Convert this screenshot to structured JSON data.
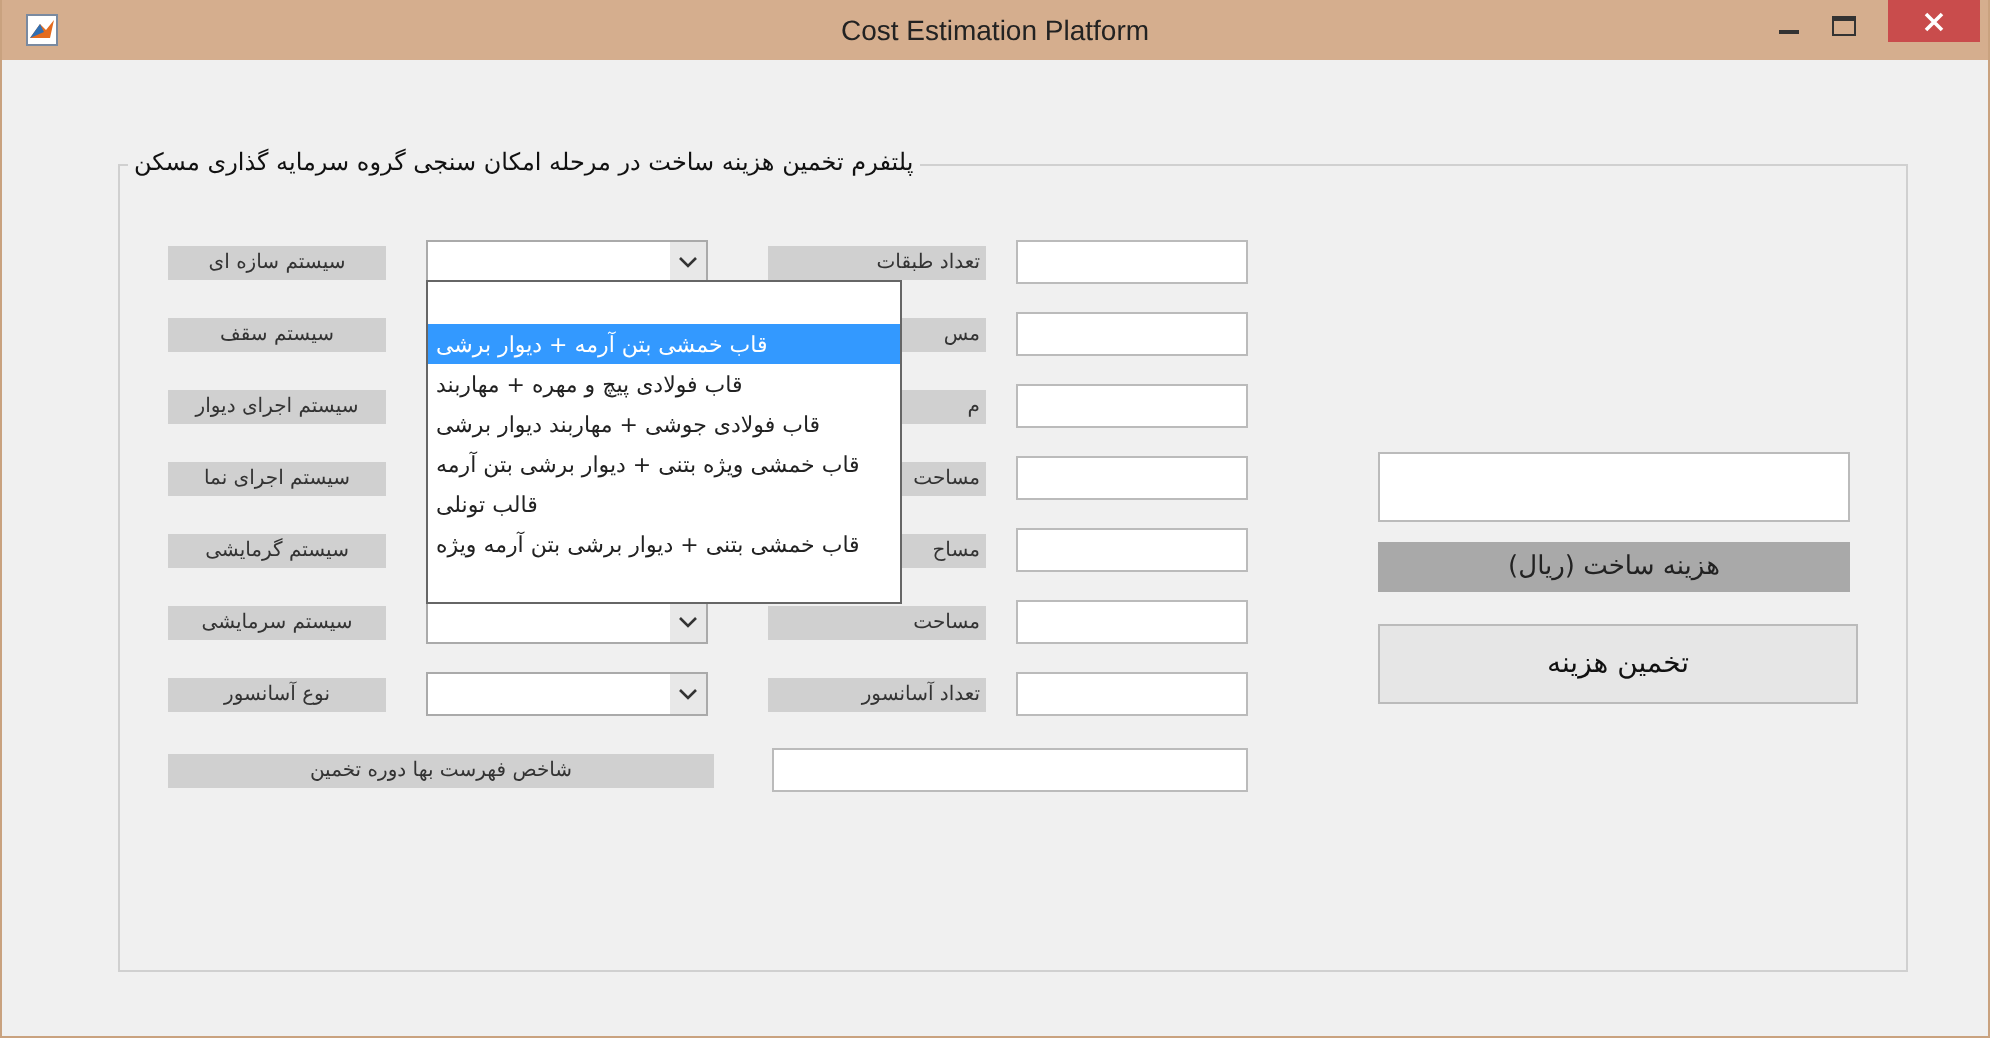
{
  "window": {
    "title": "Cost Estimation Platform"
  },
  "group": {
    "title": "پلتفرم تخمین هزینه ساخت در مرحله امکان سنجی گروه سرمایه گذاری مسکن"
  },
  "left_rows": [
    {
      "label": "سیستم سازه ای"
    },
    {
      "label": "سیستم سقف"
    },
    {
      "label": "سیستم اجرای دیوار"
    },
    {
      "label": "سیستم اجرای نما"
    },
    {
      "label": "سیستم گرمایشی"
    },
    {
      "label": "سیستم سرمایشی"
    },
    {
      "label": "نوع آسانسور"
    }
  ],
  "right_rows": [
    {
      "label": "تعداد طبقات"
    },
    {
      "label": "مس"
    },
    {
      "label": "م"
    },
    {
      "label": "مساحت"
    },
    {
      "label": "مساح"
    },
    {
      "label": "مساحت"
    },
    {
      "label": "تعداد آسانسور"
    }
  ],
  "index_row": {
    "label": "شاخص فهرست بها دوره تخمین"
  },
  "dropdown": {
    "options": [
      {
        "label": "قاب خمشی بتن آرمه + دیوار برشی",
        "selected": true
      },
      {
        "label": "قاب فولادی پیچ و مهره + مهاربند",
        "selected": false
      },
      {
        "label": "قاب فولادی جوشی + مهاربند دیوار برشی",
        "selected": false
      },
      {
        "label": "قاب خمشی ویژه بتنی + دیوار برشی بتن آرمه",
        "selected": false
      },
      {
        "label": "قالب تونلی",
        "selected": false
      },
      {
        "label": "قاب خمشی بتنی + دیوار برشی بتن آرمه ویژه",
        "selected": false
      }
    ]
  },
  "result": {
    "label": "هزینه ساخت (ریال)",
    "button": "تخمین هزینه"
  }
}
